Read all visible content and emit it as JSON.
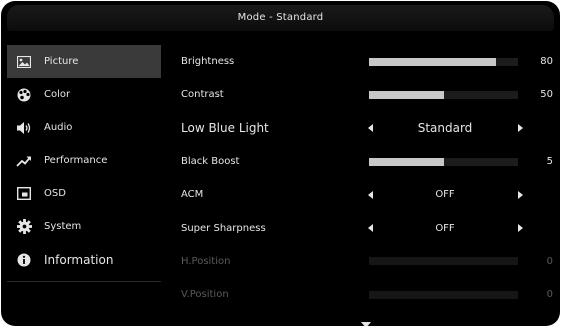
{
  "header": {
    "title": "Mode - Standard"
  },
  "sidebar": {
    "items": [
      {
        "label": "Picture",
        "icon": "picture-icon",
        "selected": true
      },
      {
        "label": "Color",
        "icon": "palette-icon",
        "selected": false
      },
      {
        "label": "Audio",
        "icon": "speaker-icon",
        "selected": false
      },
      {
        "label": "Performance",
        "icon": "performance-icon",
        "selected": false
      },
      {
        "label": "OSD",
        "icon": "osd-icon",
        "selected": false
      },
      {
        "label": "System",
        "icon": "gear-icon",
        "selected": false
      },
      {
        "label": "Information",
        "icon": "info-icon",
        "selected": false
      }
    ]
  },
  "settings": {
    "brightness": {
      "label": "Brightness",
      "value": "80",
      "level": 0.85
    },
    "contrast": {
      "label": "Contrast",
      "value": "50",
      "level": 0.5
    },
    "low_blue_light": {
      "label": "Low Blue Light",
      "value": "Standard"
    },
    "black_boost": {
      "label": "Black Boost",
      "value": "5",
      "level": 0.5
    },
    "acm": {
      "label": "ACM",
      "value": "OFF"
    },
    "super_sharpness": {
      "label": "Super Sharpness",
      "value": "OFF"
    },
    "h_position": {
      "label": "H.Position",
      "value": "0",
      "level": 0
    },
    "v_position": {
      "label": "V.Position",
      "value": "0",
      "level": 0
    }
  },
  "colors": {
    "background": "#000000",
    "selected_item": "#3a3a3a",
    "bar_fill": "#c8c8c8",
    "text": "#e6e6e6",
    "disabled_text": "#5a5a5a"
  }
}
